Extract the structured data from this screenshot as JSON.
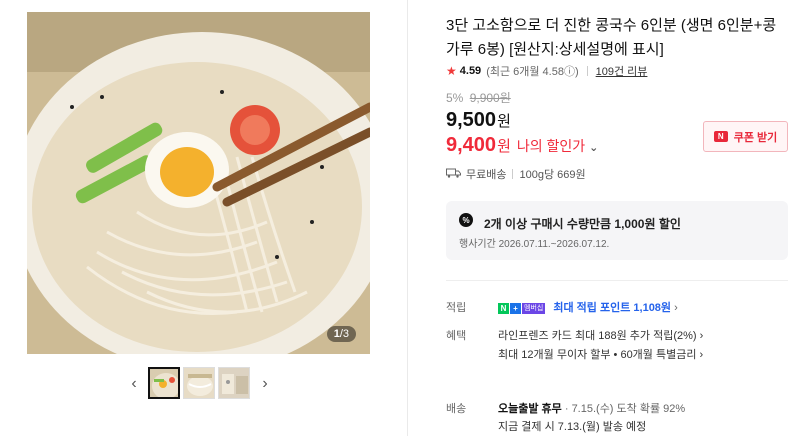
{
  "product": {
    "title": "3단 고소함으로 더 진한 콩국수 6인분 (생면 6인분+콩가루 6봉) [원산지:상세설명에 표시]",
    "image_counter_current": "1",
    "image_counter_total": "/3"
  },
  "rating": {
    "score": "4.59",
    "recent": "(최근 6개월 4.58ⓘ)",
    "reviews": "109건 리뷰"
  },
  "pricing": {
    "discount_rate": "5%",
    "original_price": "9,900원",
    "price": "9,500",
    "price_unit": "원",
    "my_price": "9,400",
    "my_price_unit": "원",
    "my_price_label": "나의 할인가",
    "my_price_chevron": "⌄"
  },
  "coupon": {
    "icon_text": "N",
    "label": "쿠폰 받기"
  },
  "shipping": {
    "free": "무료배송",
    "unit_price": "100g당 669원"
  },
  "promotion": {
    "icon_text": "%",
    "title": "2개 이상 구매시 수량만큼 1,000원 할인",
    "period": "행사기간 2026.07.11.~2026.07.12."
  },
  "details": {
    "points_label": "적립",
    "points_badge_n": "N",
    "points_badge_plus": "+",
    "points_badge_m": "멤버십",
    "points_text": "최대 적립 포인트 1,108원",
    "points_chevron": "›",
    "benefit_label": "혜택",
    "benefit_line1": "라인프렌즈 카드 최대 188원 추가 적립(2%) ›",
    "benefit_line2": "최대 12개월 무이자 할부 • 60개월 특별금리 ›",
    "delivery_label": "배송",
    "delivery_status": "오늘출발 휴무",
    "delivery_eta": "· 7.15.(수) 도착 확률 92%",
    "delivery_ship": "지금 결제 시 7.13.(월) 발송 예정"
  },
  "gallery": {
    "prev": "‹",
    "next": "›"
  },
  "colors": {
    "accent_red": "#f02a3a",
    "link_blue": "#2563eb",
    "npay_green": "#03c75a"
  }
}
